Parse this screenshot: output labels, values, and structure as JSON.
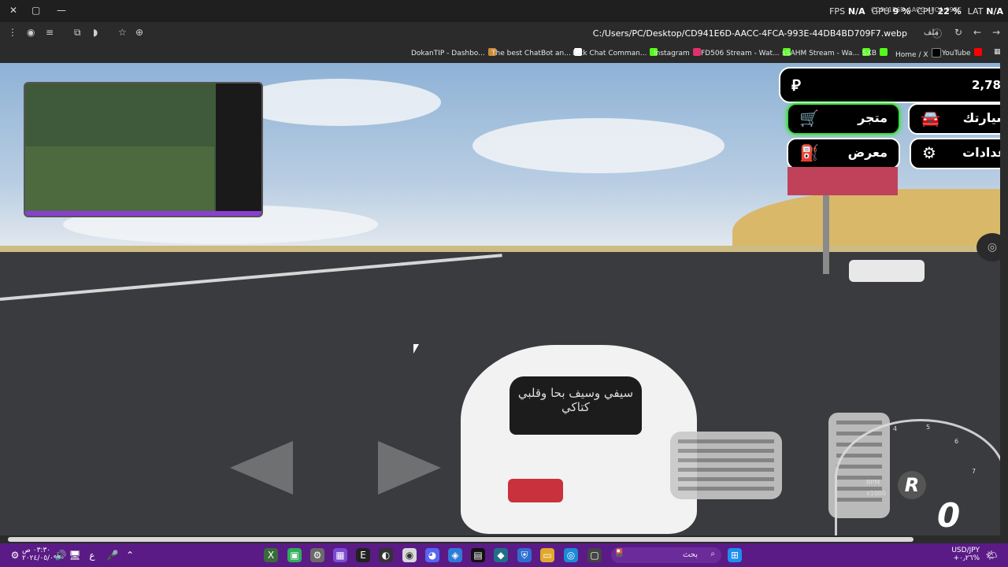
{
  "overlay": {
    "fps_label": "FPS",
    "fps_value": "N/A",
    "gpu_label": "GPU",
    "gpu_value": "9 %",
    "cpu_label": "CPU",
    "cpu_value": "22 %",
    "lat_label": "LAT",
    "lat_value": "N/A"
  },
  "tab": {
    "title": "CD941E6D-AACC-4FCA-993E"
  },
  "address": {
    "url": "C:/Users/PC/Desktop/CD941E6D-AACC-4FCA-993E-44DB4BD709F7.webp",
    "file_label": "ملف"
  },
  "bookmarks": [
    {
      "label": "DokanTIP - Dashbo...",
      "color": "#c98a3a"
    },
    {
      "label": "The best ChatBot an...",
      "color": "#ffffff"
    },
    {
      "label": "Kick Chat Comman...",
      "color": "#53fc18"
    },
    {
      "label": "Instagram",
      "color": "#e1306c"
    },
    {
      "label": "FD506 Stream - Wat...",
      "color": "#53fc18"
    },
    {
      "label": "sSAHM Stream - Wa...",
      "color": "#53fc18"
    },
    {
      "label": "SXB",
      "color": "#53fc18"
    },
    {
      "label": "Home / X",
      "color": "#000000"
    },
    {
      "label": "YouTube",
      "color": "#ff0000"
    }
  ],
  "game": {
    "currency_icon": "riyal-icon",
    "money": "2,78",
    "store_label": "متجر",
    "cars_label": "سيارتك",
    "expo_label": "معرض",
    "settings_label": "إعدادات",
    "car_window_text": "سيفي وسيف بحا وقلبي كتاكي",
    "gear": "R",
    "speed": "0",
    "tach_labels": [
      "4",
      "5",
      "6",
      "7"
    ],
    "rpm_unit": "RPM",
    "rpm_scale": "x1000",
    "accent_color": "#3ce03a"
  },
  "taskbar": {
    "clock_time": "٠٣:٣٠ ص",
    "clock_date": "٢٠٢٤/٠٥/٠٩",
    "search_placeholder": "بحث",
    "ticker_symbol": "USD/JPY",
    "ticker_change": "+٠٫٢٦%"
  }
}
